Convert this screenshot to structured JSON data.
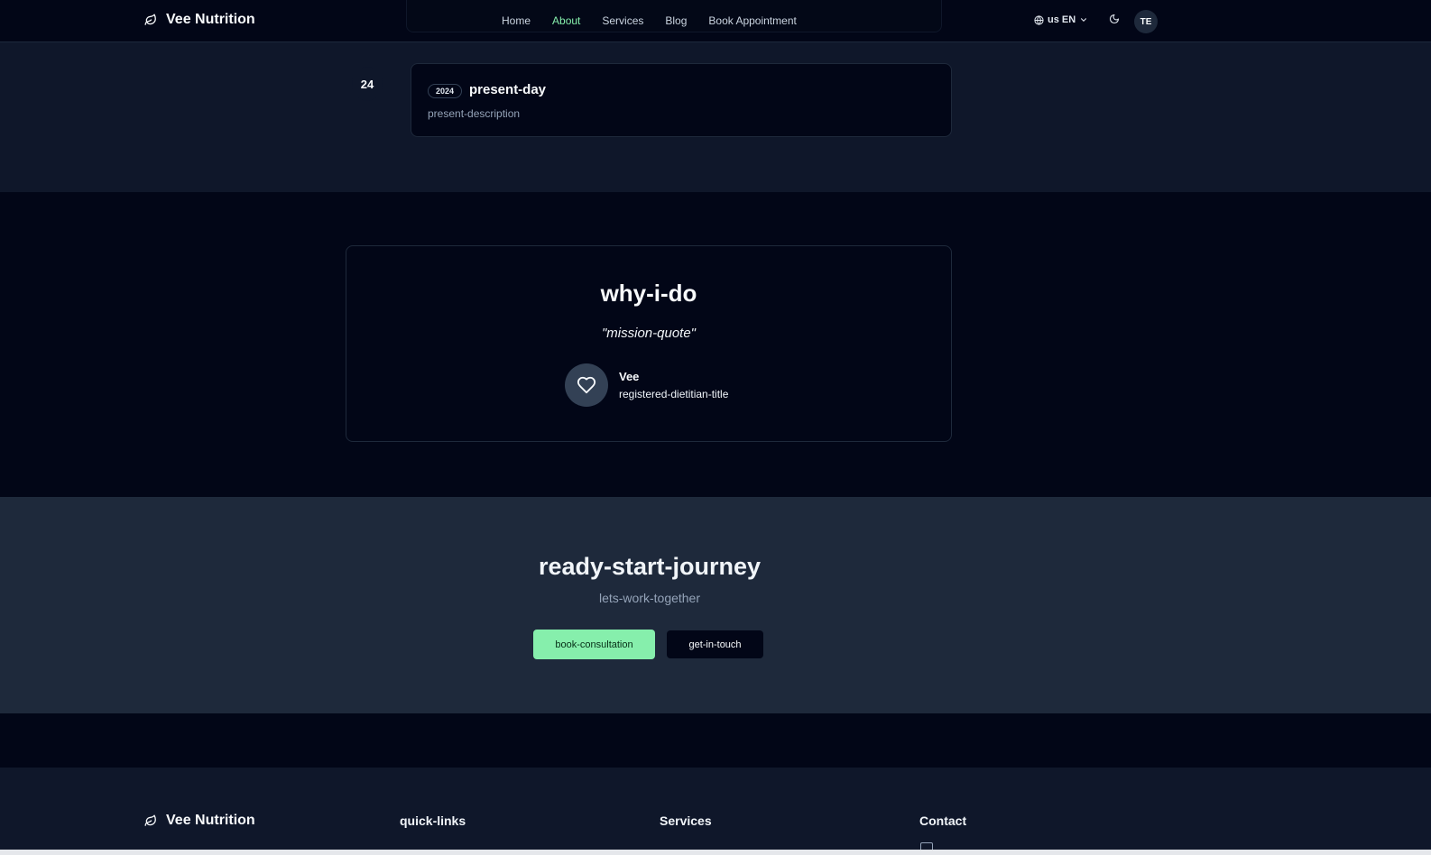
{
  "header": {
    "brand": "Vee Nutrition",
    "nav": [
      "Home",
      "About",
      "Services",
      "Blog",
      "Book Appointment"
    ],
    "active_nav": "About",
    "language": "us EN",
    "avatar_initials": "TE",
    "icons": [
      "leaf-icon",
      "globe-icon",
      "chevron-down-icon",
      "moon-icon"
    ]
  },
  "timeline": {
    "marker": "24",
    "year": "2024",
    "title": "present-day",
    "description": "present-description"
  },
  "mission": {
    "title": "why-i-do",
    "quote": "\"mission-quote\"",
    "author_name": "Vee",
    "author_title": "registered-dietitian-title",
    "icon": "heart-icon"
  },
  "cta": {
    "title": "ready-start-journey",
    "subtitle": "lets-work-together",
    "primary_button": "book-consultation",
    "secondary_button": "get-in-touch"
  },
  "footer": {
    "brand": "Vee Nutrition",
    "columns": [
      "quick-links",
      "Services",
      "Contact"
    ]
  },
  "colors": {
    "accent": "#86efac",
    "page_bg": "#020617",
    "section_bg": "#0f172a",
    "cta_bg": "#1e293b"
  }
}
